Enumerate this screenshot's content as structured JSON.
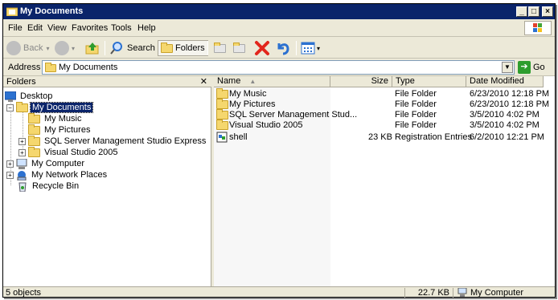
{
  "window": {
    "title": "My Documents"
  },
  "menu": {
    "file": "File",
    "edit": "Edit",
    "view": "View",
    "favorites": "Favorites",
    "tools": "Tools",
    "help": "Help"
  },
  "toolbar": {
    "back": "Back",
    "search": "Search",
    "folders": "Folders"
  },
  "address": {
    "label": "Address",
    "value": "My Documents",
    "go": "Go"
  },
  "folders_pane": {
    "title": "Folders",
    "tree": [
      {
        "label": "Desktop"
      },
      {
        "label": "My Documents"
      },
      {
        "label": "My Music"
      },
      {
        "label": "My Pictures"
      },
      {
        "label": "SQL Server Management Studio Express"
      },
      {
        "label": "Visual Studio 2005"
      },
      {
        "label": "My Computer"
      },
      {
        "label": "My Network Places"
      },
      {
        "label": "Recycle Bin"
      }
    ]
  },
  "columns": {
    "name": "Name",
    "size": "Size",
    "type": "Type",
    "date": "Date Modified"
  },
  "files": [
    {
      "name": "My Music",
      "size": "",
      "type": "File Folder",
      "date": "6/23/2010 12:18 PM"
    },
    {
      "name": "My Pictures",
      "size": "",
      "type": "File Folder",
      "date": "6/23/2010 12:18 PM"
    },
    {
      "name": "SQL Server Management Stud...",
      "size": "",
      "type": "File Folder",
      "date": "3/5/2010 4:02 PM"
    },
    {
      "name": "Visual Studio 2005",
      "size": "",
      "type": "File Folder",
      "date": "3/5/2010 4:02 PM"
    },
    {
      "name": "shell",
      "size": "23 KB",
      "type": "Registration Entries",
      "date": "6/2/2010 12:21 PM"
    }
  ],
  "status": {
    "objects": "5 objects",
    "size": "22.7 KB",
    "location": "My Computer"
  },
  "colors": {
    "title_bg": "#0a246a",
    "selection": "#0a246a",
    "chrome": "#ece9d8",
    "folder": "#f5d76e"
  }
}
